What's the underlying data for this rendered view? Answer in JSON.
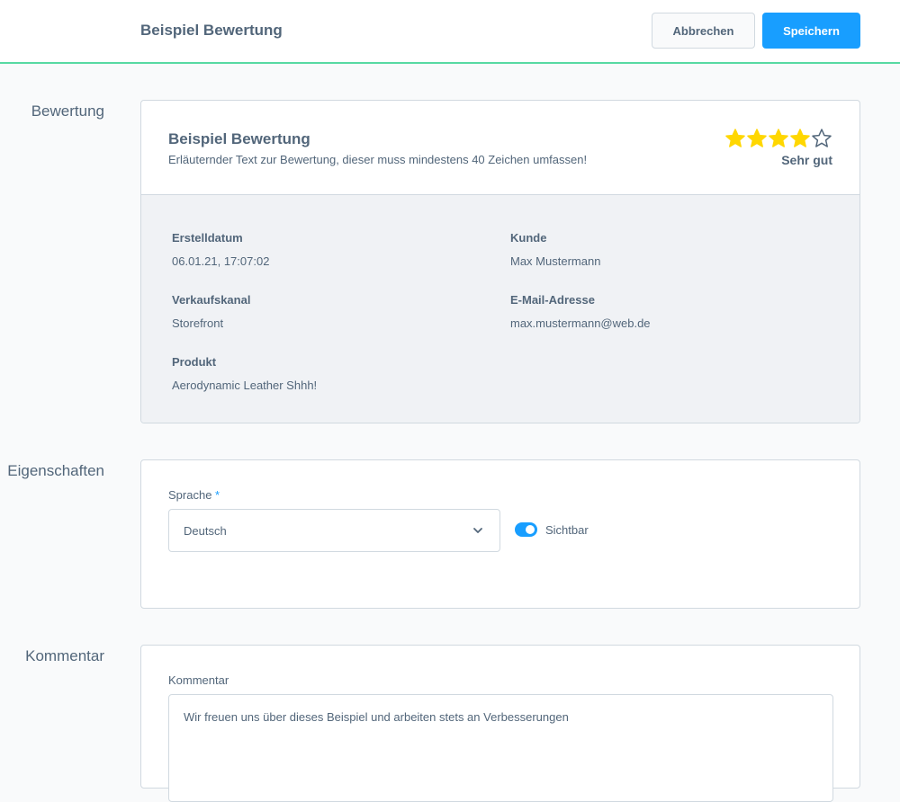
{
  "header": {
    "title": "Beispiel Bewertung",
    "cancel_label": "Abbrechen",
    "save_label": "Speichern"
  },
  "sections": {
    "rating": "Bewertung",
    "properties": "Eigenschaften",
    "comment": "Kommentar"
  },
  "review": {
    "title": "Beispiel Bewertung",
    "description": "Erläuternder Text zur Bewertung, dieser muss mindestens 40 Zeichen umfassen!",
    "stars": 4,
    "max_stars": 5,
    "rating_text": "Sehr gut",
    "star_color": "#ffd700",
    "meta": {
      "created_label": "Erstelldatum",
      "created_value": "06.01.21, 17:07:02",
      "customer_label": "Kunde",
      "customer_value": "Max Mustermann",
      "channel_label": "Verkaufskanal",
      "channel_value": "Storefront",
      "email_label": "E-Mail-Adresse",
      "email_value": "max.mustermann@web.de",
      "product_label": "Produkt",
      "product_value": "Aerodynamic Leather Shhh!"
    }
  },
  "properties": {
    "language_label": "Sprache",
    "language_required": "*",
    "language_value": "Deutsch",
    "visible_label": "Sichtbar",
    "visible_on": true
  },
  "comment": {
    "label": "Kommentar",
    "value": "Wir freuen uns über dieses Beispiel und arbeiten stets an Verbesserungen"
  },
  "colors": {
    "accent": "#189eff",
    "header_border": "#57d9a3",
    "text": "#52667a"
  }
}
